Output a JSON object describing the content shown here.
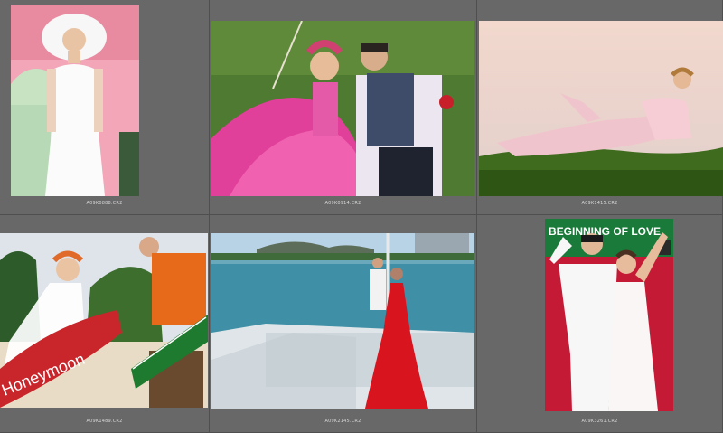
{
  "thumbnails": [
    {
      "filename": "A09K0888.CR2",
      "alt": "Bride in white hat beside vintage car"
    },
    {
      "filename": "A09K0914.CR2",
      "alt": "Couple sitting on grass with pink gown"
    },
    {
      "filename": "A09K1415.CR2",
      "alt": "Bride reclining on hill"
    },
    {
      "filename": "A09K1489.CR2",
      "alt": "Couple with surfboard and road sign"
    },
    {
      "filename": "A09K2145.CR2",
      "alt": "Bride in red dress on boat"
    },
    {
      "filename": "A09K3261.CR2",
      "alt": "Couple in white at Beginning of Love sign"
    }
  ],
  "signs": {
    "surfboard_text": "Honeymoon",
    "sign_text": "BEGINNING OF LOVE"
  }
}
